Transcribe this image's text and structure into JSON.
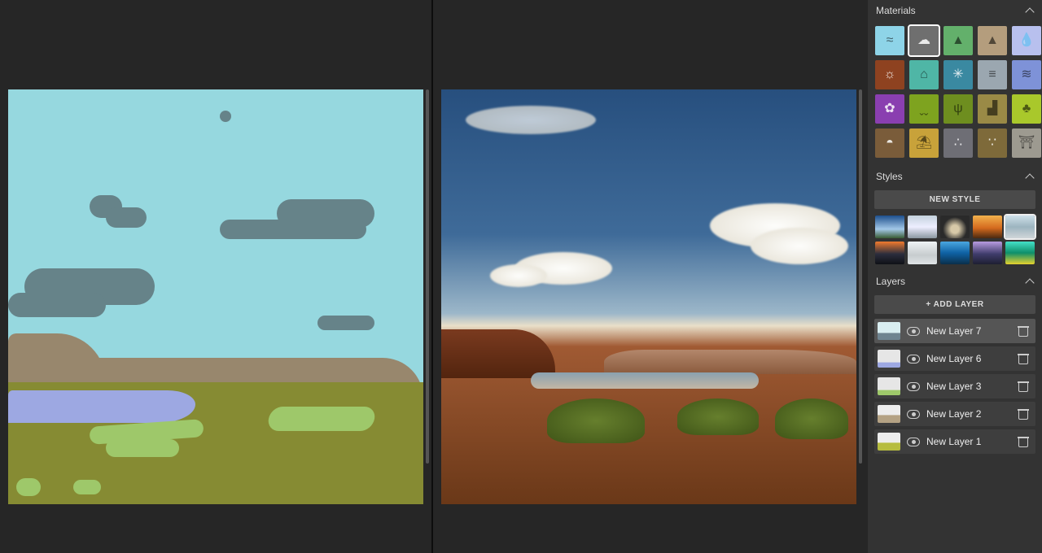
{
  "panels": {
    "materials": {
      "title": "Materials"
    },
    "styles": {
      "title": "Styles",
      "new_style_label": "NEW STYLE"
    },
    "layers": {
      "title": "Layers",
      "add_layer_label": "+ ADD LAYER"
    }
  },
  "materials": [
    {
      "name": "sky",
      "bg": "#8ed4e8",
      "glyph": "≈",
      "light": false,
      "selected": false
    },
    {
      "name": "cloud",
      "bg": "#6f6f6f",
      "glyph": "☁",
      "light": true,
      "selected": true
    },
    {
      "name": "hill",
      "bg": "#63b06b",
      "glyph": "▲",
      "light": false,
      "selected": false
    },
    {
      "name": "mountain",
      "bg": "#b49d7d",
      "glyph": "▲",
      "light": false,
      "selected": false
    },
    {
      "name": "water",
      "bg": "#b8c0ee",
      "glyph": "💧",
      "light": false,
      "selected": false
    },
    {
      "name": "fire",
      "bg": "#8e4220",
      "glyph": "☼",
      "light": true,
      "selected": false
    },
    {
      "name": "haze",
      "bg": "#4fb6a6",
      "glyph": "⌂",
      "light": false,
      "selected": false
    },
    {
      "name": "snow",
      "bg": "#3a89a1",
      "glyph": "✳",
      "light": true,
      "selected": false
    },
    {
      "name": "fog",
      "bg": "#9ba7b0",
      "glyph": "≡",
      "light": false,
      "selected": false
    },
    {
      "name": "sea",
      "bg": "#7e92d8",
      "glyph": "≋",
      "light": false,
      "selected": false
    },
    {
      "name": "flower",
      "bg": "#8a3fb0",
      "glyph": "✿",
      "light": true,
      "selected": false
    },
    {
      "name": "grass",
      "bg": "#7ea31f",
      "glyph": "ˬˬ",
      "light": false,
      "selected": false
    },
    {
      "name": "bush",
      "bg": "#6e8e1f",
      "glyph": "ψ",
      "light": false,
      "selected": false
    },
    {
      "name": "dirt",
      "bg": "#9a8a46",
      "glyph": "▟",
      "light": false,
      "selected": false
    },
    {
      "name": "tree",
      "bg": "#a9c82b",
      "glyph": "♣",
      "light": false,
      "selected": false
    },
    {
      "name": "rock",
      "bg": "#7a5c3a",
      "glyph": "◓",
      "light": true,
      "selected": false
    },
    {
      "name": "sand",
      "bg": "#c8a23a",
      "glyph": "⛱",
      "light": false,
      "selected": false
    },
    {
      "name": "gravel",
      "bg": "#6e6e75",
      "glyph": "∴",
      "light": true,
      "selected": false
    },
    {
      "name": "mud",
      "bg": "#7e6a3a",
      "glyph": "∵",
      "light": true,
      "selected": false
    },
    {
      "name": "stone",
      "bg": "#9d9a90",
      "glyph": "⛩",
      "light": false,
      "selected": false
    }
  ],
  "styles": [
    {
      "name": "style-1",
      "bg": "linear-gradient(#1d4f8c,#a3c8e8 60%,#395b33)",
      "selected": false
    },
    {
      "name": "style-2",
      "bg": "linear-gradient(#c4d2dd,#eef 50%,#8a97a0)",
      "selected": false
    },
    {
      "name": "style-3",
      "bg": "radial-gradient(circle at 50% 60%,#d7c9a8 20%,#2a2a2a 60%)",
      "selected": false
    },
    {
      "name": "style-4",
      "bg": "linear-gradient(#f2b24d,#d46a1e 55%,#4a2910)",
      "selected": false
    },
    {
      "name": "style-5",
      "bg": "linear-gradient(#cfe1ea,#9cb4bf 50%,#d0d6d9)",
      "selected": true
    },
    {
      "name": "style-6",
      "bg": "linear-gradient(#f07b2e,#2b2d3d 55%,#0f1116)",
      "selected": false
    },
    {
      "name": "style-7",
      "bg": "linear-gradient(#eef3f5,#c7ccce 60%,#dfe4e6)",
      "selected": false
    },
    {
      "name": "style-8",
      "bg": "linear-gradient(#4aa7e0,#0f62a4 50%,#0a2f4b)",
      "selected": false
    },
    {
      "name": "style-9",
      "bg": "linear-gradient(#b89be0,#3f3c6b 55%,#1e1f32)",
      "selected": false
    },
    {
      "name": "style-10",
      "bg": "linear-gradient(#44e0c8,#0e8f6a 50%,#e7d22e)",
      "selected": false
    }
  ],
  "layers": [
    {
      "name": "New Layer 7",
      "thumb": "linear-gradient(#d9eef1 60%,#6f8490 62%,#6f8490)",
      "selected": true
    },
    {
      "name": "New Layer 6",
      "thumb": "linear-gradient(#e6e6e6 70%,#9da8e2 72%,#9da8e2)",
      "selected": false
    },
    {
      "name": "New Layer 3",
      "thumb": "linear-gradient(#e6e6e6 70%,#9ec86a 72%,#9ec86a)",
      "selected": false
    },
    {
      "name": "New Layer 2",
      "thumb": "linear-gradient(#ededed 55%,#b4a284 58%,#b4a284)",
      "selected": false
    },
    {
      "name": "New Layer 1",
      "thumb": "linear-gradient(#ededed 55%,#b7bd3f 58%,#b7bd3f)",
      "selected": false
    }
  ]
}
